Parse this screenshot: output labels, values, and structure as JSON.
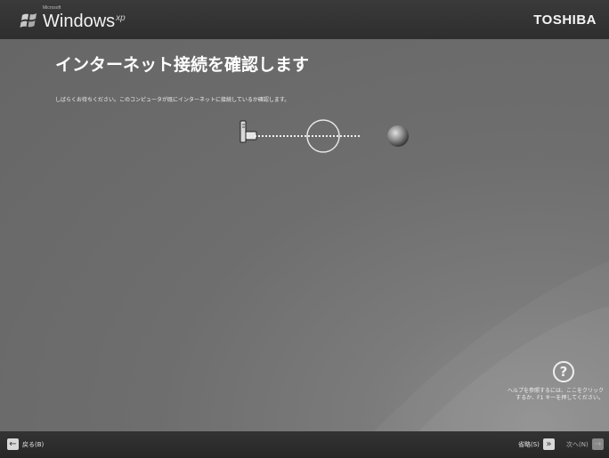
{
  "header": {
    "microsoft": "Microsoft",
    "windows": "Windows",
    "xp": "xp",
    "brand": "TOSHIBA"
  },
  "main": {
    "title": "インターネット接続を確認します",
    "description": "しばらくお待ちください。このコンピュータが既にインターネットに接続しているか確認します。"
  },
  "help": {
    "icon": "?",
    "lines": [
      "ヘルプを参照するには、ここをクリック",
      "するか、F1 キーを押してください。"
    ]
  },
  "footer": {
    "back_label": "戻る(B)",
    "skip_label": "省略(S)",
    "next_label": "次へ(N)",
    "back_icon": "←",
    "skip_icon": "»",
    "next_icon": "→"
  },
  "colors": {
    "bar": "#2e2e2e",
    "background": "#6e6e6e",
    "text": "#ffffff"
  }
}
